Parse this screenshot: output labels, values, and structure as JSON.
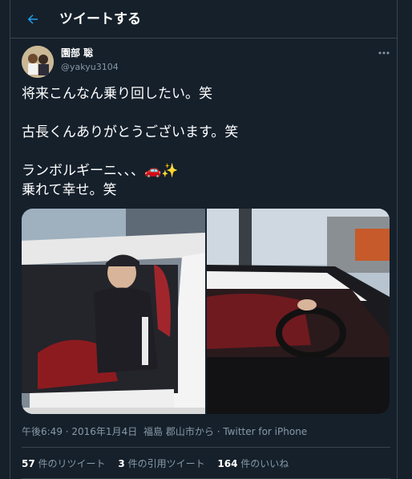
{
  "header": {
    "title": "ツイートする",
    "back_icon": "arrow-left-icon"
  },
  "tweet": {
    "author_name": "園部 聡",
    "author_handle": "@yakyu3104",
    "text": "将来こんなん乗り回したい。笑\n\n古長くんありがとうございます。笑\n\nランボルギーニ、、、🚗✨\n乗れて幸せ。笑",
    "timestamp": "午後6:49 · 2016年1月4日",
    "location": "福島 郡山市から",
    "source": "Twitter for iPhone"
  },
  "stats": {
    "retweets_count": "57",
    "retweets_label": "件のリツイート",
    "quotes_count": "3",
    "quotes_label": "件の引用ツイート",
    "likes_count": "164",
    "likes_label": "件のいいね"
  },
  "colors": {
    "background": "#15202b",
    "accent": "#1da1f2",
    "muted": "#8899a6",
    "border": "#38444d"
  }
}
